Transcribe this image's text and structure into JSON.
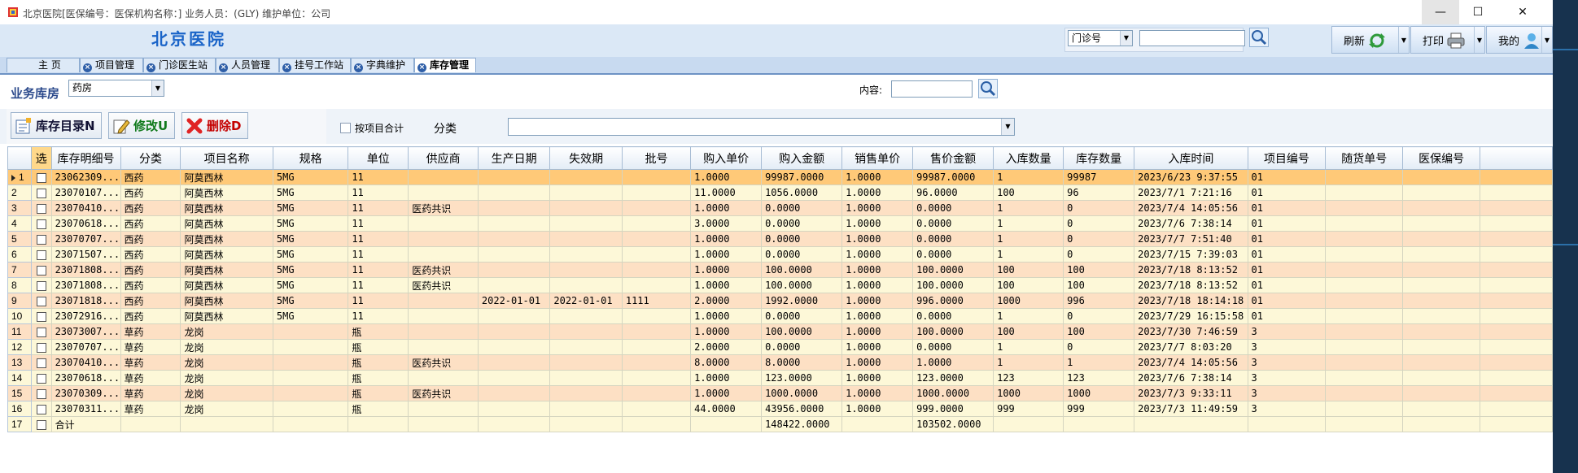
{
  "window": {
    "title": "北京医院[医保编号：医保机构名称：] 业务人员：(GLY) 维护单位：公司",
    "controls": [
      "—",
      "☐",
      "✕"
    ]
  },
  "header": {
    "brand": "北京医院",
    "dept_select": "门诊号",
    "buttons": {
      "refresh": "刷新",
      "print": "打印",
      "mine": "我的"
    }
  },
  "tabs": [
    {
      "label": "主  页",
      "closable": false,
      "active": false
    },
    {
      "label": "项目管理",
      "closable": true,
      "active": false
    },
    {
      "label": "门诊医生站",
      "closable": true,
      "active": false
    },
    {
      "label": "人员管理",
      "closable": true,
      "active": false
    },
    {
      "label": "挂号工作站",
      "closable": true,
      "active": false
    },
    {
      "label": "字典维护",
      "closable": true,
      "active": false
    },
    {
      "label": "库存管理",
      "closable": true,
      "active": true
    }
  ],
  "filter": {
    "warehouse_label": "业务库房",
    "warehouse_value": "药房",
    "content_label": "内容:",
    "content_value": "",
    "group_checkbox_label": "按项目合计",
    "category_label": "分类",
    "category_value": ""
  },
  "actions": {
    "catalog": "库存目录N",
    "edit": "修改U",
    "delete": "删除D"
  },
  "grid": {
    "columns": [
      "选",
      "库存明细号",
      "分类",
      "项目名称",
      "规格",
      "单位",
      "供应商",
      "生产日期",
      "失效期",
      "批号",
      "购入单价",
      "购入金额",
      "销售单价",
      "售价金额",
      "入库数量",
      "库存数量",
      "入库时间",
      "项目编号",
      "随货单号",
      "医保编号"
    ],
    "rows": [
      [
        "1",
        "23062309...",
        "西药",
        "阿莫西林",
        "5MG",
        "11",
        "",
        "",
        "",
        "",
        "1.0000",
        "99987.0000",
        "1.0000",
        "99987.0000",
        "1",
        "99987",
        "2023/6/23 9:37:55",
        "01",
        "",
        ""
      ],
      [
        "2",
        "23070107...",
        "西药",
        "阿莫西林",
        "5MG",
        "11",
        "",
        "",
        "",
        "",
        "11.0000",
        "1056.0000",
        "1.0000",
        "96.0000",
        "100",
        "96",
        "2023/7/1 7:21:16",
        "01",
        "",
        ""
      ],
      [
        "3",
        "23070410...",
        "西药",
        "阿莫西林",
        "5MG",
        "11",
        "医药共识",
        "",
        "",
        "",
        "1.0000",
        "0.0000",
        "1.0000",
        "0.0000",
        "1",
        "0",
        "2023/7/4 14:05:56",
        "01",
        "",
        ""
      ],
      [
        "4",
        "23070618...",
        "西药",
        "阿莫西林",
        "5MG",
        "11",
        "",
        "",
        "",
        "",
        "3.0000",
        "0.0000",
        "1.0000",
        "0.0000",
        "1",
        "0",
        "2023/7/6 7:38:14",
        "01",
        "",
        ""
      ],
      [
        "5",
        "23070707...",
        "西药",
        "阿莫西林",
        "5MG",
        "11",
        "",
        "",
        "",
        "",
        "1.0000",
        "0.0000",
        "1.0000",
        "0.0000",
        "1",
        "0",
        "2023/7/7 7:51:40",
        "01",
        "",
        ""
      ],
      [
        "6",
        "23071507...",
        "西药",
        "阿莫西林",
        "5MG",
        "11",
        "",
        "",
        "",
        "",
        "1.0000",
        "0.0000",
        "1.0000",
        "0.0000",
        "1",
        "0",
        "2023/7/15 7:39:03",
        "01",
        "",
        ""
      ],
      [
        "7",
        "23071808...",
        "西药",
        "阿莫西林",
        "5MG",
        "11",
        "医药共识",
        "",
        "",
        "",
        "1.0000",
        "100.0000",
        "1.0000",
        "100.0000",
        "100",
        "100",
        "2023/7/18 8:13:52",
        "01",
        "",
        ""
      ],
      [
        "8",
        "23071808...",
        "西药",
        "阿莫西林",
        "5MG",
        "11",
        "医药共识",
        "",
        "",
        "",
        "1.0000",
        "100.0000",
        "1.0000",
        "100.0000",
        "100",
        "100",
        "2023/7/18 8:13:52",
        "01",
        "",
        ""
      ],
      [
        "9",
        "23071818...",
        "西药",
        "阿莫西林",
        "5MG",
        "11",
        "",
        "2022-01-01",
        "2022-01-01",
        "1111",
        "2.0000",
        "1992.0000",
        "1.0000",
        "996.0000",
        "1000",
        "996",
        "2023/7/18 18:14:18",
        "01",
        "",
        ""
      ],
      [
        "10",
        "23072916...",
        "西药",
        "阿莫西林",
        "5MG",
        "11",
        "",
        "",
        "",
        "",
        "1.0000",
        "0.0000",
        "1.0000",
        "0.0000",
        "1",
        "0",
        "2023/7/29 16:15:58",
        "01",
        "",
        ""
      ],
      [
        "11",
        "23073007...",
        "草药",
        "龙岗",
        "",
        "瓶",
        "",
        "",
        "",
        "",
        "1.0000",
        "100.0000",
        "1.0000",
        "100.0000",
        "100",
        "100",
        "2023/7/30 7:46:59",
        "3",
        "",
        ""
      ],
      [
        "12",
        "23070707...",
        "草药",
        "龙岗",
        "",
        "瓶",
        "",
        "",
        "",
        "",
        "2.0000",
        "0.0000",
        "1.0000",
        "0.0000",
        "1",
        "0",
        "2023/7/7 8:03:20",
        "3",
        "",
        ""
      ],
      [
        "13",
        "23070410...",
        "草药",
        "龙岗",
        "",
        "瓶",
        "医药共识",
        "",
        "",
        "",
        "8.0000",
        "8.0000",
        "1.0000",
        "1.0000",
        "1",
        "1",
        "2023/7/4 14:05:56",
        "3",
        "",
        ""
      ],
      [
        "14",
        "23070618...",
        "草药",
        "龙岗",
        "",
        "瓶",
        "",
        "",
        "",
        "",
        "1.0000",
        "123.0000",
        "1.0000",
        "123.0000",
        "123",
        "123",
        "2023/7/6 7:38:14",
        "3",
        "",
        ""
      ],
      [
        "15",
        "23070309...",
        "草药",
        "龙岗",
        "",
        "瓶",
        "医药共识",
        "",
        "",
        "",
        "1.0000",
        "1000.0000",
        "1.0000",
        "1000.0000",
        "1000",
        "1000",
        "2023/7/3 9:33:11",
        "3",
        "",
        ""
      ],
      [
        "16",
        "23070311...",
        "草药",
        "龙岗",
        "",
        "瓶",
        "",
        "",
        "",
        "",
        "44.0000",
        "43956.0000",
        "1.0000",
        "999.0000",
        "999",
        "999",
        "2023/7/3 11:49:59",
        "3",
        "",
        ""
      ]
    ],
    "total_row": {
      "index": "17",
      "label": "合计",
      "purchase_amount": "148422.0000",
      "sale_amount": "103502.0000"
    },
    "current_row": 1
  }
}
